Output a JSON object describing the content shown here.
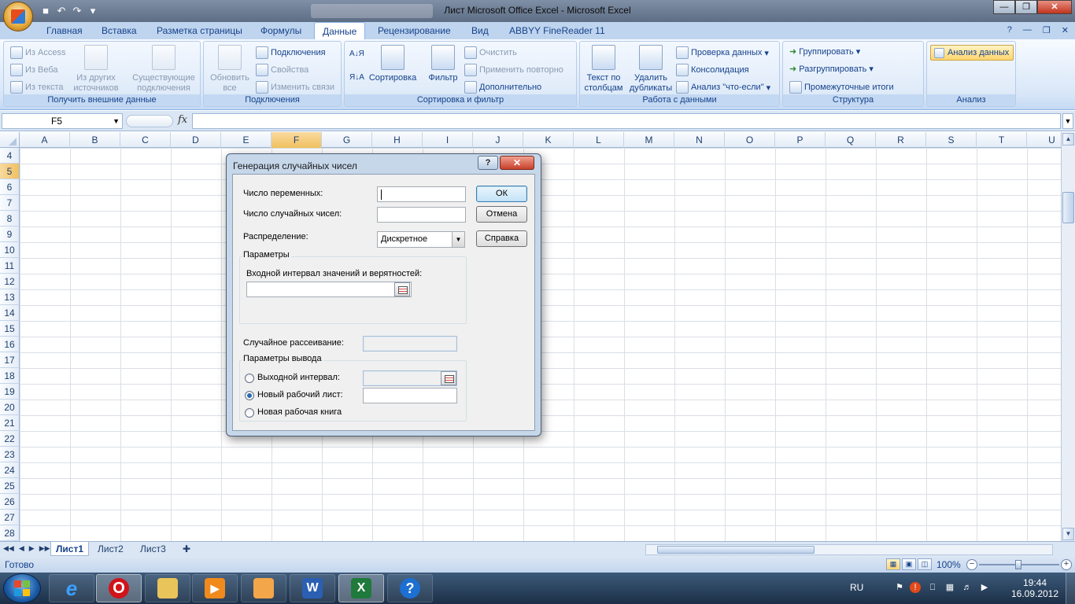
{
  "window": {
    "title": "Лист Microsoft Office Excel - Microsoft Excel"
  },
  "ribbon_tabs": [
    "Главная",
    "Вставка",
    "Разметка страницы",
    "Формулы",
    "Данные",
    "Рецензирование",
    "Вид",
    "ABBYY FineReader 11"
  ],
  "active_tab": "Данные",
  "groups": {
    "external": {
      "label": "Получить внешние данные",
      "from_access": "Из Access",
      "from_web": "Из Веба",
      "from_text": "Из текста",
      "from_other": "Из других источников",
      "existing": "Существующие подключения"
    },
    "connections": {
      "label": "Подключения",
      "refresh_all": "Обновить все",
      "connections": "Подключения",
      "properties": "Свойства",
      "edit_links": "Изменить связи"
    },
    "sort_filter": {
      "label": "Сортировка и фильтр",
      "sort": "Сортировка",
      "filter": "Фильтр",
      "clear": "Очистить",
      "reapply": "Применить повторно",
      "advanced": "Дополнительно"
    },
    "data_tools": {
      "label": "Работа с данными",
      "text_to_columns": "Текст по столбцам",
      "remove_duplicates": "Удалить дубликаты",
      "validation": "Проверка данных",
      "consolidate": "Консолидация",
      "what_if": "Анализ \"что-если\""
    },
    "outline": {
      "label": "Структура",
      "group": "Группировать",
      "ungroup": "Разгруппировать",
      "subtotal": "Промежуточные итоги"
    },
    "analysis": {
      "label": "Анализ",
      "data_analysis": "Анализ данных"
    }
  },
  "formula_bar": {
    "name_box": "F5",
    "fx": "fx",
    "value": ""
  },
  "columns": [
    "A",
    "B",
    "C",
    "D",
    "E",
    "F",
    "G",
    "H",
    "I",
    "J",
    "K",
    "L",
    "M",
    "N",
    "O",
    "P",
    "Q",
    "R",
    "S",
    "T",
    "U"
  ],
  "selected_column": "F",
  "rows": [
    "4",
    "5",
    "6",
    "7",
    "8",
    "9",
    "10",
    "11",
    "12",
    "13",
    "14",
    "15",
    "16",
    "17",
    "18",
    "19",
    "20",
    "21",
    "22",
    "23",
    "24",
    "25",
    "26",
    "27",
    "28"
  ],
  "selected_row": "5",
  "sheets": [
    "Лист1",
    "Лист2",
    "Лист3"
  ],
  "active_sheet": "Лист1",
  "status": {
    "ready": "Готово",
    "zoom": "100%"
  },
  "dialog": {
    "title": "Генерация случайных чисел",
    "num_variables_label": "Число переменных:",
    "num_random_label": "Число случайных чисел:",
    "distribution_label": "Распределение:",
    "distribution_value": "Дискретное",
    "params_legend": "Параметры",
    "input_range_label": "Входной интервал значений и верятностей:",
    "seed_label": "Случайное рассеивание:",
    "output_legend": "Параметры вывода",
    "output_range_label": "Выходной интервал:",
    "new_sheet_label": "Новый рабочий лист:",
    "new_book_label": "Новая рабочая книга",
    "ok": "ОК",
    "cancel": "Отмена",
    "help": "Справка",
    "selected_output": "new_sheet"
  },
  "taskbar": {
    "lang": "RU",
    "time": "19:44",
    "date": "16.09.2012"
  }
}
